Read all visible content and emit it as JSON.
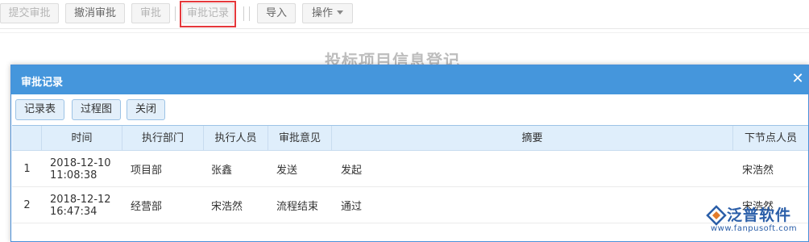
{
  "toolbar": {
    "submit_label": "提交审批",
    "revoke_label": "撤消审批",
    "approve_label": "审批",
    "records_label": "审批记录",
    "import_label": "导入",
    "operate_label": "操作"
  },
  "page": {
    "title": "投标项目信息登记"
  },
  "dialog": {
    "title": "审批记录",
    "close_glyph": "✕",
    "buttons": {
      "records_table": "记录表",
      "process_chart": "过程图",
      "close": "关闭"
    },
    "table": {
      "headers": [
        "",
        "时间",
        "执行部门",
        "执行人员",
        "审批意见",
        "摘要",
        "下节点人员"
      ],
      "rows": [
        {
          "no": "1",
          "date": "2018-12-10",
          "time": "11:08:38",
          "dept": "项目部",
          "person": "张鑫",
          "opinion": "发送",
          "summary": "发起",
          "next": "宋浩然"
        },
        {
          "no": "2",
          "date": "2018-12-12",
          "time": "16:47:34",
          "dept": "经营部",
          "person": "宋浩然",
          "opinion": "流程结束",
          "summary": "通过",
          "next": "宋浩然"
        }
      ]
    }
  },
  "watermark": {
    "brand": "泛普软件",
    "url": "www.fanpusoft.com",
    "color": "#2a5ea8"
  }
}
